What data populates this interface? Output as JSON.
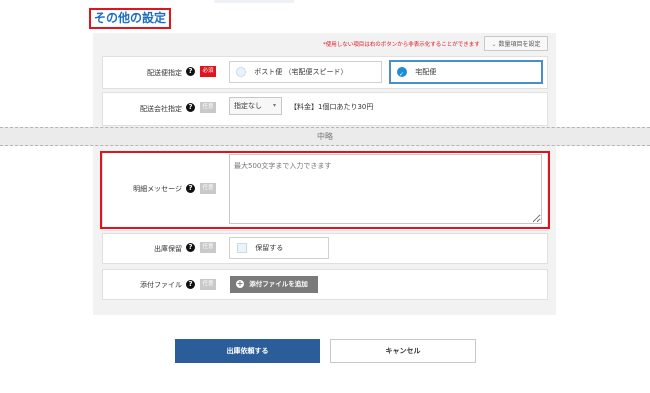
{
  "section": {
    "title": "その他の設定"
  },
  "top_note": "*使用しない項目は右のボタンから非表示化することができます",
  "settings_button": {
    "label": "数量項目を設定",
    "icon": "chevron-down-icon"
  },
  "badges": {
    "required": "必須",
    "optional": "任意"
  },
  "help_icon": "?",
  "delivery_method": {
    "label": "配送便指定",
    "options": [
      {
        "label": "ポスト便 （宅配便スピード）",
        "selected": false
      },
      {
        "label": "宅配便",
        "selected": true
      }
    ]
  },
  "carrier": {
    "label": "配送会社指定",
    "select_value": "指定なし",
    "fee_note": "【料金】1個口あたり30円"
  },
  "omitted_label": "中略",
  "message": {
    "label": "明細メッセージ",
    "placeholder": "最大500文字まで入力できます"
  },
  "hold": {
    "label": "出庫保留",
    "checkbox_label": "保留する",
    "checked": false
  },
  "attachment": {
    "label": "添付ファイル",
    "button_label": "添付ファイルを追加"
  },
  "footer": {
    "submit_label": "出庫依頼する",
    "cancel_label": "キャンセル"
  },
  "colors": {
    "accent_red": "#e0141e",
    "primary_blue": "#2b5d9b",
    "radio_selected": "#1f8dd6",
    "title_blue": "#1a6fc4"
  }
}
